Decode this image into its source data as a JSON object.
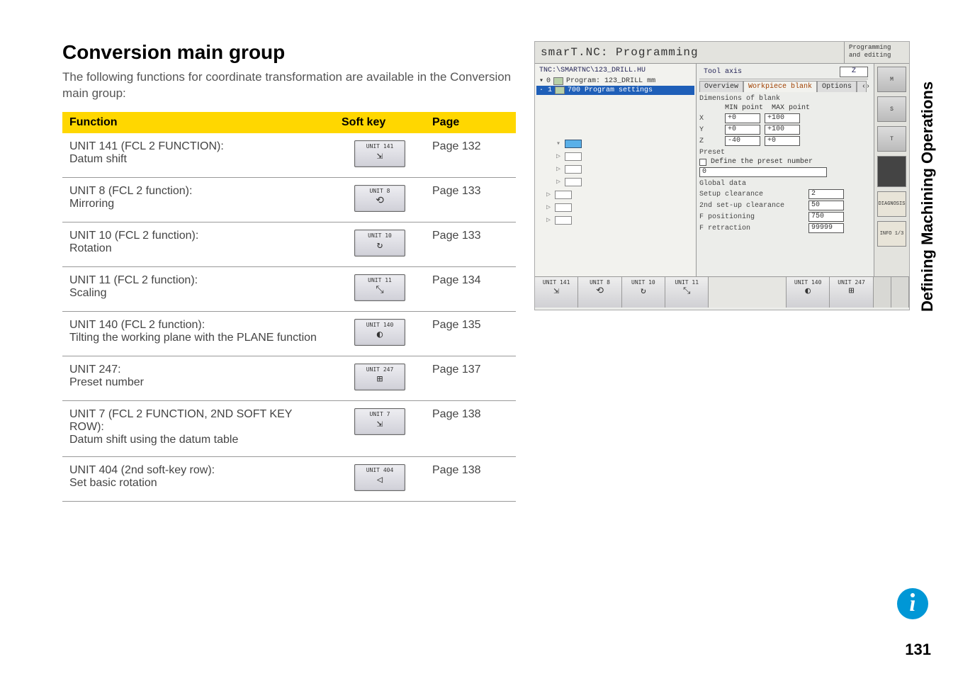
{
  "heading": "Conversion main group",
  "intro": "The following functions for coordinate transformation are available in the Conversion main group:",
  "table": {
    "headers": {
      "func": "Function",
      "soft": "Soft key",
      "page": "Page"
    },
    "rows": [
      {
        "func_l1": "UNIT 141 (FCL 2 FUNCTION):",
        "func_l2": "Datum shift",
        "softkey": "UNIT 141",
        "glyph": "⇲",
        "page": "Page 132"
      },
      {
        "func_l1": "UNIT 8 (FCL 2 function):",
        "func_l2": "Mirroring",
        "softkey": "UNIT 8",
        "glyph": "⟲",
        "page": "Page 133"
      },
      {
        "func_l1": "UNIT 10 (FCL 2 function):",
        "func_l2": "Rotation",
        "softkey": "UNIT 10",
        "glyph": "↻",
        "page": "Page 133"
      },
      {
        "func_l1": "UNIT 11 (FCL 2 function):",
        "func_l2": "Scaling",
        "softkey": "UNIT 11",
        "glyph": "⤡",
        "page": "Page 134"
      },
      {
        "func_l1": "UNIT 140 (FCL 2 function):",
        "func_l2": "Tilting the working plane with the PLANE function",
        "softkey": "UNIT 140",
        "glyph": "◐",
        "page": "Page 135"
      },
      {
        "func_l1": "UNIT 247:",
        "func_l2": "Preset number",
        "softkey": "UNIT 247",
        "glyph": "⊞",
        "page": "Page 137"
      },
      {
        "func_l1": "UNIT 7 (FCL 2 FUNCTION, 2ND SOFT KEY ROW):",
        "func_l2": "Datum shift using the datum table",
        "softkey": "UNIT 7",
        "glyph": "⇲",
        "page": "Page 138"
      },
      {
        "func_l1": "UNIT 404 (2nd soft-key row):",
        "func_l2": "Set basic rotation",
        "softkey": "UNIT 404",
        "glyph": "◁",
        "page": "Page 138"
      }
    ]
  },
  "sidebar_title": "Defining Machining Operations",
  "screenshot": {
    "title": "smarT.NC: Programming",
    "mode_l1": "Programming",
    "mode_l2": "and editing",
    "path": "TNC:\\SMARTNC\\123_DRILL.HU",
    "tree_row_0": "0",
    "tree_row_0_txt": "Program: 123_DRILL mm",
    "tree_row_1": "· 1",
    "tree_row_1_txt": "700 Program settings",
    "tool_axis_lbl": "Tool axis",
    "tool_axis_val": "Z",
    "tabs": {
      "overview": "Overview",
      "workpiece": "Workpiece blank",
      "options": "Options"
    },
    "dim_label": "Dimensions of blank",
    "min_label": "MIN point",
    "max_label": "MAX point",
    "axes": {
      "x": {
        "lbl": "X",
        "min": "+0",
        "max": "+100"
      },
      "y": {
        "lbl": "Y",
        "min": "+0",
        "max": "+100"
      },
      "z": {
        "lbl": "Z",
        "min": "-40",
        "max": "+0"
      }
    },
    "preset_label": "Preset",
    "preset_check": "Define the preset number",
    "preset_val": "0",
    "global_label": "Global data",
    "setup_clear_lbl": "Setup clearance",
    "setup_clear_val": "2",
    "second_clear_lbl": "2nd set-up clearance",
    "second_clear_val": "50",
    "fpos_lbl": "F positioning",
    "fpos_val": "750",
    "fret_lbl": "F retraction",
    "fret_val": "99999",
    "icons": {
      "m": "M",
      "s": "S",
      "t": "T",
      "diag": "DIAGNOSIS",
      "info": "INFO 1/3"
    },
    "softkeys": [
      {
        "label": "UNIT 141",
        "glyph": "⇲"
      },
      {
        "label": "UNIT 8",
        "glyph": "⟲"
      },
      {
        "label": "UNIT 10",
        "glyph": "↻"
      },
      {
        "label": "UNIT 11",
        "glyph": "⤡"
      },
      {
        "label": "",
        "glyph": ""
      },
      {
        "label": "UNIT 140",
        "glyph": "◐"
      },
      {
        "label": "UNIT 247",
        "glyph": "⊞"
      }
    ]
  },
  "page_number": "131"
}
